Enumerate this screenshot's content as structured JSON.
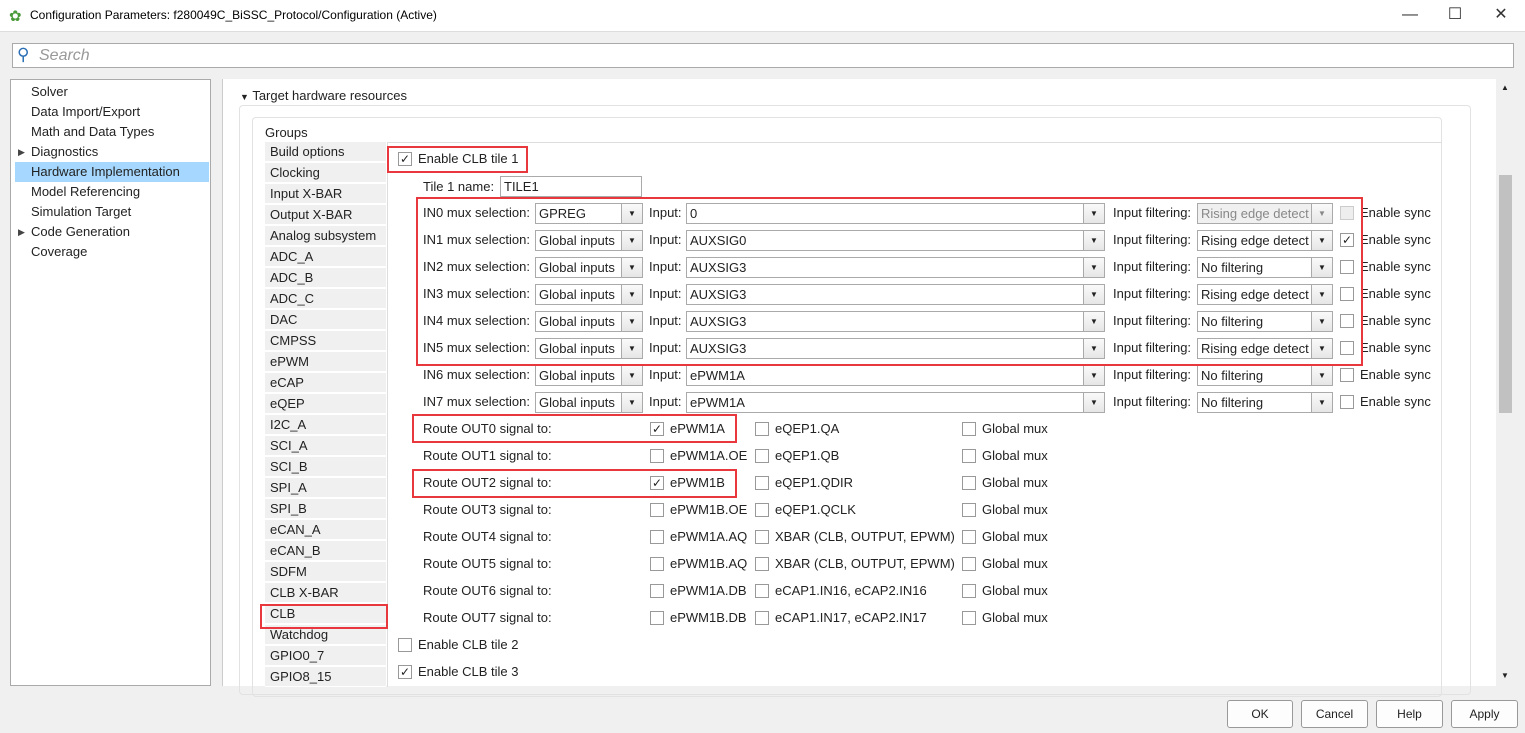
{
  "window": {
    "title": "Configuration Parameters: f280049C_BiSSC_Protocol/Configuration (Active)",
    "minimize": "—",
    "maximize": "☐",
    "close": "✕"
  },
  "search": {
    "placeholder": "Search"
  },
  "tree": [
    {
      "label": "Solver"
    },
    {
      "label": "Data Import/Export"
    },
    {
      "label": "Math and Data Types"
    },
    {
      "label": "Diagnostics",
      "expandable": true
    },
    {
      "label": "Hardware Implementation",
      "selected": true
    },
    {
      "label": "Model Referencing"
    },
    {
      "label": "Simulation Target"
    },
    {
      "label": "Code Generation",
      "expandable": true
    },
    {
      "label": "Coverage"
    }
  ],
  "section": {
    "title": "Target hardware resources",
    "groups_label": "Groups"
  },
  "groups": [
    "Build options",
    "Clocking",
    "Input X-BAR",
    "Output X-BAR",
    "Analog subsystem",
    "ADC_A",
    "ADC_B",
    "ADC_C",
    "DAC",
    "CMPSS",
    "ePWM",
    "eCAP",
    "eQEP",
    "I2C_A",
    "SCI_A",
    "SCI_B",
    "SPI_A",
    "SPI_B",
    "eCAN_A",
    "eCAN_B",
    "SDFM",
    "CLB X-BAR",
    "CLB",
    "Watchdog",
    "GPIO0_7",
    "GPIO8_15"
  ],
  "selected_group": "CLB",
  "tile1": {
    "label": "Enable CLB tile 1",
    "checked": true,
    "name_label": "Tile 1 name:",
    "name_value": "TILE1"
  },
  "labels": {
    "input": "Input:",
    "filtering": "Input filtering:",
    "sync": "Enable sync"
  },
  "mux_rows": [
    {
      "label": "IN0 mux selection:",
      "mux": "GPREG",
      "input": "0",
      "filter": "Rising edge detect",
      "filter_disabled": true,
      "sync": false,
      "sync_disabled": true
    },
    {
      "label": "IN1 mux selection:",
      "mux": "Global inputs",
      "input": "AUXSIG0",
      "filter": "Rising edge detect",
      "sync": true
    },
    {
      "label": "IN2 mux selection:",
      "mux": "Global inputs",
      "input": "AUXSIG3",
      "filter": "No filtering",
      "sync": false
    },
    {
      "label": "IN3 mux selection:",
      "mux": "Global inputs",
      "input": "AUXSIG3",
      "filter": "Rising edge detect",
      "sync": false
    },
    {
      "label": "IN4 mux selection:",
      "mux": "Global inputs",
      "input": "AUXSIG3",
      "filter": "No filtering",
      "sync": false
    },
    {
      "label": "IN5 mux selection:",
      "mux": "Global inputs",
      "input": "AUXSIG3",
      "filter": "Rising edge detect",
      "sync": false
    },
    {
      "label": "IN6 mux selection:",
      "mux": "Global inputs",
      "input": "ePWM1A",
      "filter": "No filtering",
      "sync": false
    },
    {
      "label": "IN7 mux selection:",
      "mux": "Global inputs",
      "input": "ePWM1A",
      "filter": "No filtering",
      "sync": false
    }
  ],
  "out_rows": [
    {
      "label": "Route OUT0 signal to:",
      "opts": [
        {
          "t": "ePWM1A",
          "c": true
        },
        {
          "t": "eQEP1.QA",
          "c": false
        },
        {
          "t": "Global mux",
          "c": false
        }
      ]
    },
    {
      "label": "Route OUT1 signal to:",
      "opts": [
        {
          "t": "ePWM1A.OE",
          "c": false
        },
        {
          "t": "eQEP1.QB",
          "c": false
        },
        {
          "t": "Global mux",
          "c": false
        }
      ]
    },
    {
      "label": "Route OUT2 signal to:",
      "opts": [
        {
          "t": "ePWM1B",
          "c": true
        },
        {
          "t": "eQEP1.QDIR",
          "c": false
        },
        {
          "t": "Global mux",
          "c": false
        }
      ]
    },
    {
      "label": "Route OUT3 signal to:",
      "opts": [
        {
          "t": "ePWM1B.OE",
          "c": false
        },
        {
          "t": "eQEP1.QCLK",
          "c": false
        },
        {
          "t": "Global mux",
          "c": false
        }
      ]
    },
    {
      "label": "Route OUT4 signal to:",
      "opts": [
        {
          "t": "ePWM1A.AQ",
          "c": false
        },
        {
          "t": "XBAR (CLB, OUTPUT, EPWM)",
          "c": false
        },
        {
          "t": "Global mux",
          "c": false
        }
      ]
    },
    {
      "label": "Route OUT5 signal to:",
      "opts": [
        {
          "t": "ePWM1B.AQ",
          "c": false
        },
        {
          "t": "XBAR (CLB, OUTPUT, EPWM)",
          "c": false
        },
        {
          "t": "Global mux",
          "c": false
        }
      ]
    },
    {
      "label": "Route OUT6 signal to:",
      "opts": [
        {
          "t": "ePWM1A.DB",
          "c": false
        },
        {
          "t": "eCAP1.IN16, eCAP2.IN16",
          "c": false
        },
        {
          "t": "Global mux",
          "c": false
        }
      ]
    },
    {
      "label": "Route OUT7 signal to:",
      "opts": [
        {
          "t": "ePWM1B.DB",
          "c": false
        },
        {
          "t": "eCAP1.IN17, eCAP2.IN17",
          "c": false
        },
        {
          "t": "Global mux",
          "c": false
        }
      ]
    }
  ],
  "tile2": {
    "label": "Enable CLB tile 2",
    "checked": false
  },
  "tile3": {
    "label": "Enable CLB tile 3",
    "checked": true
  },
  "buttons": {
    "ok": "OK",
    "cancel": "Cancel",
    "help": "Help",
    "apply": "Apply"
  },
  "colors": {
    "highlight": "#e8383d",
    "selection": "#a6d8ff"
  }
}
